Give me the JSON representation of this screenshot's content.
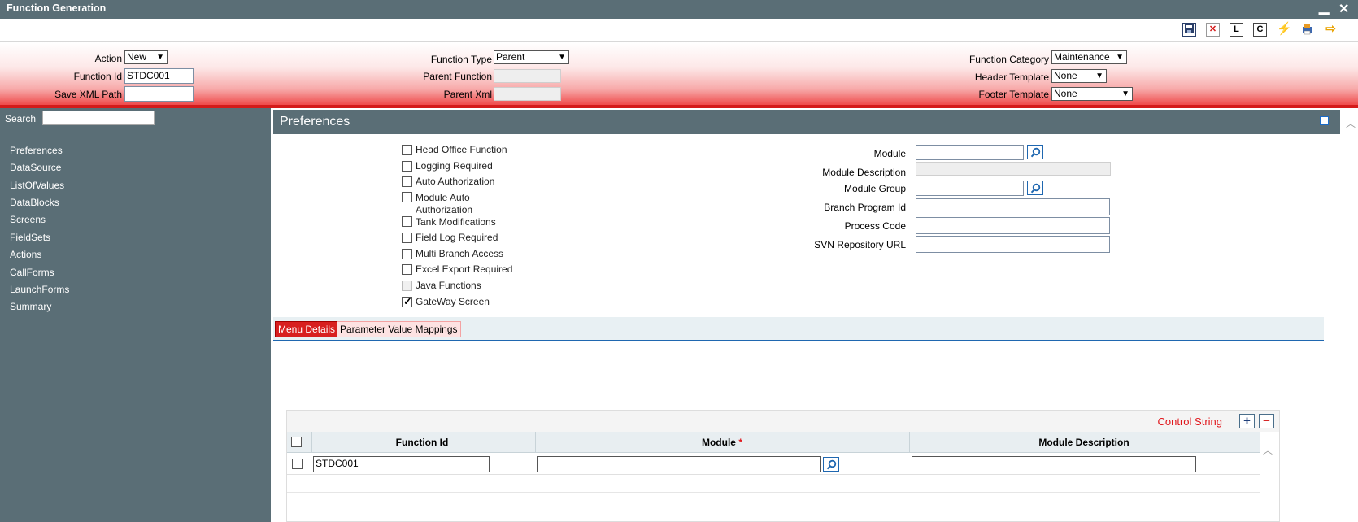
{
  "window": {
    "title": "Function Generation",
    "minimize_glyph": "▁",
    "close_glyph": "✕"
  },
  "toolbar": {
    "icons": [
      "save-icon",
      "delete-icon",
      "load-icon",
      "close-icon",
      "generate-icon",
      "print-icon",
      "exit-arrow-icon"
    ],
    "L_label": "L",
    "C_label": "C"
  },
  "header": {
    "action_label": "Action",
    "action_value": "New",
    "function_id_label": "Function Id",
    "function_id_value": "STDC001",
    "save_xml_path_label": "Save XML Path",
    "save_xml_path_value": "",
    "function_type_label": "Function Type",
    "function_type_value": "Parent",
    "parent_function_label": "Parent Function",
    "parent_function_value": "",
    "parent_xml_label": "Parent Xml",
    "parent_xml_value": "",
    "function_category_label": "Function Category",
    "function_category_value": "Maintenance",
    "header_template_label": "Header Template",
    "header_template_value": "None",
    "footer_template_label": "Footer Template",
    "footer_template_value": "None"
  },
  "sidebar": {
    "search_label": "Search",
    "items": [
      "Preferences",
      "DataSource",
      "ListOfValues",
      "DataBlocks",
      "Screens",
      "FieldSets",
      "Actions",
      "CallForms",
      "LaunchForms",
      "Summary"
    ]
  },
  "preferences": {
    "title": "Preferences",
    "checkboxes": [
      {
        "label": "Head Office Function",
        "checked": false
      },
      {
        "label": "Logging Required",
        "checked": false
      },
      {
        "label": "Auto Authorization",
        "checked": false
      },
      {
        "label": "Module Auto",
        "label2": "Authorization",
        "checked": false
      },
      {
        "label": "Tank Modifications",
        "checked": false
      },
      {
        "label": "Field Log Required",
        "checked": false
      },
      {
        "label": "Multi Branch Access",
        "checked": false
      },
      {
        "label": "Excel Export Required",
        "checked": false
      },
      {
        "label": "Java Functions",
        "checked": false,
        "disabled": true
      },
      {
        "label": "GateWay Screen",
        "checked": true
      }
    ],
    "module_label": "Module",
    "module_description_label": "Module Description",
    "module_group_label": "Module Group",
    "branch_program_id_label": "Branch Program Id",
    "process_code_label": "Process Code",
    "svn_repository_url_label": "SVN Repository URL"
  },
  "tabs": [
    {
      "label": "Menu Details",
      "active": true
    },
    {
      "label": "Parameter Value Mappings",
      "active": false
    }
  ],
  "grid": {
    "control_label": "Control String",
    "add_glyph": "+",
    "remove_glyph": "−",
    "columns": [
      "Function Id",
      "Module",
      "Module Description"
    ],
    "required_mark": "*",
    "rows": [
      {
        "function_id": "STDC001",
        "module": "",
        "module_description": ""
      }
    ]
  },
  "colors": {
    "nav_bg": "#5a6e76",
    "accent_red": "#d41a1a",
    "link_blue": "#1f67b0"
  }
}
